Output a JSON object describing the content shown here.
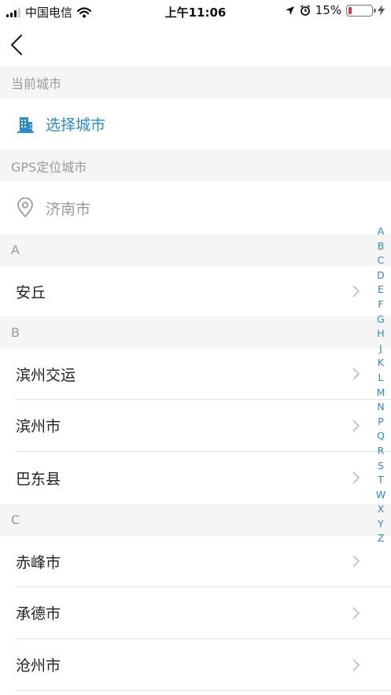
{
  "status_bar": {
    "carrier": "中国电信",
    "time": "上午11:06",
    "battery": "15%"
  },
  "sections": {
    "current_city": "当前城市",
    "gps": "GPS定位城市"
  },
  "select_city": {
    "label": "选择城市"
  },
  "gps_city": {
    "label": "济南市"
  },
  "groups": [
    {
      "letter": "A",
      "cities": [
        "安丘"
      ]
    },
    {
      "letter": "B",
      "cities": [
        "滨州交运",
        "滨州市",
        "巴东县"
      ]
    },
    {
      "letter": "C",
      "cities": [
        "赤峰市",
        "承德市",
        "沧州市"
      ]
    }
  ],
  "index_letters": [
    "A",
    "B",
    "C",
    "D",
    "E",
    "F",
    "G",
    "H",
    "J",
    "K",
    "L",
    "M",
    "N",
    "P",
    "Q",
    "R",
    "S",
    "T",
    "W",
    "X",
    "Y",
    "Z"
  ],
  "colors": {
    "accent": "#2b8ad1",
    "header_bg": "#f5f5f5",
    "battery_low": "#e53935"
  }
}
